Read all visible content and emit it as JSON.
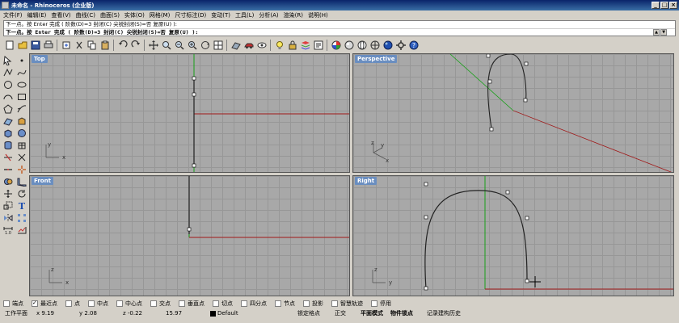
{
  "window": {
    "title": "未命名 - Rhinoceros (企业版)",
    "buttons": [
      "_",
      "□",
      "×"
    ]
  },
  "menu": [
    "文件(F)",
    "编辑(E)",
    "查看(V)",
    "曲线(C)",
    "曲面(S)",
    "实体(O)",
    "网格(M)",
    "尺寸标注(D)",
    "变动(T)",
    "工具(L)",
    "分析(A)",
    "渲染(R)",
    "说明(H)"
  ],
  "command": {
    "history": "下一点。按 Enter 完成 ( 阶数(D)=3  封闭(C)  尖锐封闭(S)=否  复原(U) ):",
    "prompt": "下一点。按 Enter 完成 ( 阶数(D)=3  封闭(C)  尖锐封闭(S)=否  复原(U) ):"
  },
  "toolbar_icons": [
    "new-icon",
    "open-icon",
    "save-icon",
    "print-icon",
    "import-icon",
    "cut-icon",
    "copy-icon",
    "paste-icon",
    "undo-icon",
    "redo-icon",
    "pan-icon",
    "zoom-window-icon",
    "zoom-extents-icon",
    "zoom-selected-icon",
    "rotate-view-icon",
    "four-viewports-icon",
    "cplane-icon",
    "car-icon",
    "hide-icon",
    "light-icon",
    "lock-icon",
    "layer-icon",
    "properties-icon",
    "color-icon",
    "render-icon",
    "shaded-icon",
    "wireframe-icon",
    "sphere-icon",
    "options-icon",
    "help-icon"
  ],
  "palette_icons": [
    "select-icon",
    "point-icon",
    "polyline-icon",
    "curve-icon",
    "circle-icon",
    "ellipse-icon",
    "arc-icon",
    "rectangle-icon",
    "polygon-icon",
    "freeform-icon",
    "surface-icon",
    "extrude-icon",
    "box-icon",
    "sphere-solid-icon",
    "cylinder-icon",
    "mesh-icon",
    "trim-icon",
    "split-icon",
    "join-icon",
    "explode-icon",
    "boolean-icon",
    "fillet-icon",
    "move-icon",
    "rotate-icon",
    "scale-icon",
    "text-icon",
    "mirror-icon",
    "array-icon",
    "dimension-icon",
    "analyze-icon"
  ],
  "viewports": [
    {
      "label": "Top",
      "axis_labels": [
        "y",
        "x"
      ]
    },
    {
      "label": "Perspective",
      "axis_labels": [
        "z",
        "y",
        "x"
      ]
    },
    {
      "label": "Front",
      "axis_labels": [
        "z",
        "x"
      ]
    },
    {
      "label": "Right",
      "axis_labels": [
        "z",
        "y"
      ]
    }
  ],
  "snaps": [
    {
      "label": "端点",
      "checked": false
    },
    {
      "label": "最近点",
      "checked": true
    },
    {
      "label": "点",
      "checked": false
    },
    {
      "label": "中点",
      "checked": false
    },
    {
      "label": "中心点",
      "checked": false
    },
    {
      "label": "交点",
      "checked": false
    },
    {
      "label": "垂直点",
      "checked": false
    },
    {
      "label": "切点",
      "checked": false
    },
    {
      "label": "四分点",
      "checked": false
    },
    {
      "label": "节点",
      "checked": false
    },
    {
      "label": "投影",
      "checked": false
    },
    {
      "label": "智慧轨迹",
      "checked": false
    },
    {
      "label": "停用",
      "checked": false
    }
  ],
  "status": {
    "cplane": "工作平面",
    "x": "x 9.19",
    "y": "y 2.08",
    "z": "z -0.22",
    "value": "15.97",
    "layer": "Default",
    "grid_snap": "锁定格点",
    "ortho": "正交",
    "planar": "平面模式",
    "osnap": "物件锁点",
    "history": "记录建构历史"
  },
  "colors": {
    "viewport_bg": "#a8a8a8",
    "grid": "#979797",
    "x_axis": "#a01818",
    "y_axis": "#18a018",
    "label_bg": "#6a8ec0"
  }
}
